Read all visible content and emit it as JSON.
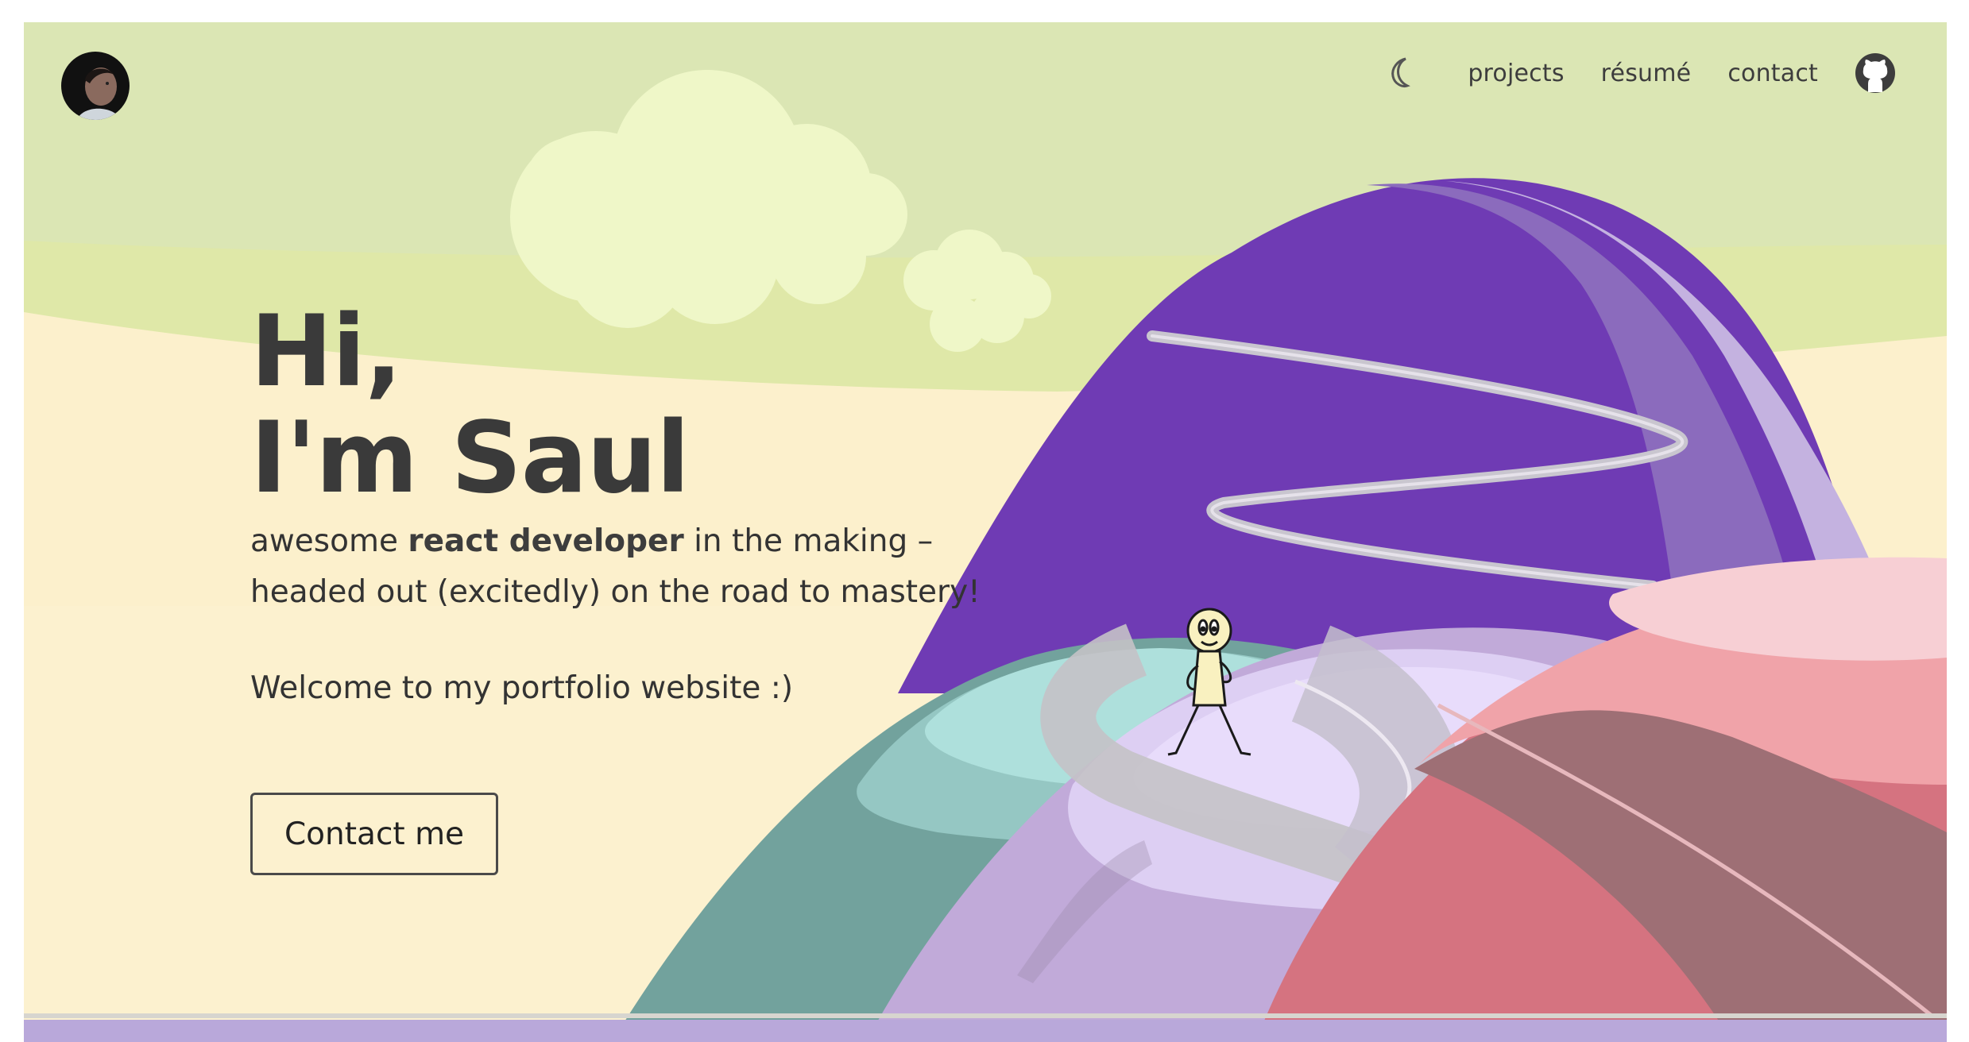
{
  "header": {
    "avatar_alt": "Saul avatar",
    "nav": [
      {
        "label": "projects"
      },
      {
        "label": "résumé"
      },
      {
        "label": "contact"
      }
    ]
  },
  "hero": {
    "line1": "Hi,",
    "line2": "I'm Saul",
    "sub_part1": "awesome ",
    "sub_bold": "react developer",
    "sub_part2": " in the making –",
    "sub_line2": "headed out (excitedly) on the road to mastery!",
    "welcome": "Welcome to my portfolio website :)",
    "cta_label": "Contact me"
  },
  "colors": {
    "sky": "#dbe6b4",
    "band": "#dfe8a8",
    "sand": "#fdf2cf",
    "purple": "#6f3bb4",
    "lavender": "#c4b3e0",
    "teal": "#72a29d",
    "pink": "#d57380",
    "text": "#3a3a3a"
  },
  "icons": [
    "moon-icon",
    "github-icon"
  ]
}
